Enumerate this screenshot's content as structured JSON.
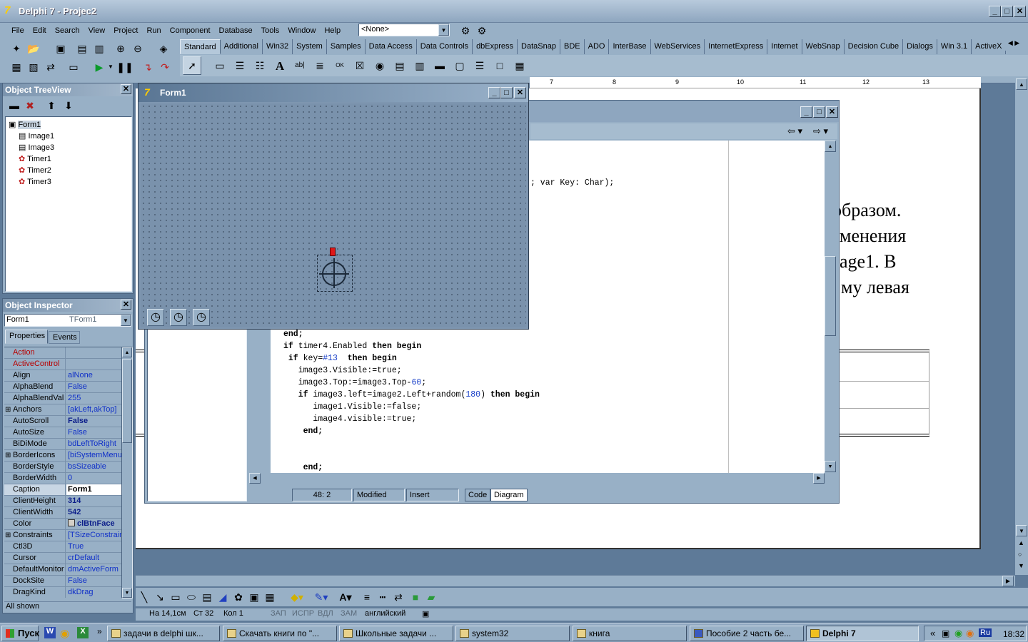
{
  "window": {
    "title": "Delphi 7 - Projec2"
  },
  "menu": [
    "File",
    "Edit",
    "Search",
    "View",
    "Project",
    "Run",
    "Component",
    "Database",
    "Tools",
    "Window",
    "Help"
  ],
  "toolbar": {
    "desktop_combo": "<None>"
  },
  "palette_tabs": [
    "Standard",
    "Additional",
    "Win32",
    "System",
    "Samples",
    "Data Access",
    "Data Controls",
    "dbExpress",
    "DataSnap",
    "BDE",
    "ADO",
    "InterBase",
    "WebServices",
    "InternetExpress",
    "Internet",
    "WebSnap",
    "Decision Cube",
    "Dialogs",
    "Win 3.1",
    "ActiveX"
  ],
  "ruler_numbers": [
    "7",
    "8",
    "9",
    "10",
    "11",
    "12",
    "13"
  ],
  "tree_view": {
    "title": "Object TreeView",
    "items": [
      "Form1",
      "Image1",
      "Image3",
      "Timer1",
      "Timer2",
      "Timer3"
    ]
  },
  "inspector": {
    "title": "Object Inspector",
    "object_name": "Form1",
    "object_type": "TForm1",
    "tabs": [
      "Properties",
      "Events"
    ],
    "status": "All shown",
    "props": [
      {
        "name": "Action",
        "value": "",
        "red": true
      },
      {
        "name": "ActiveControl",
        "value": "",
        "red": true
      },
      {
        "name": "Align",
        "value": "alNone"
      },
      {
        "name": "AlphaBlend",
        "value": "False"
      },
      {
        "name": "AlphaBlendVal",
        "value": "255"
      },
      {
        "name": "Anchors",
        "value": "[akLeft,akTop]",
        "plus": true
      },
      {
        "name": "AutoScroll",
        "value": "False",
        "bold": true
      },
      {
        "name": "AutoSize",
        "value": "False"
      },
      {
        "name": "BiDiMode",
        "value": "bdLeftToRight"
      },
      {
        "name": "BorderIcons",
        "value": "[biSystemMenu,",
        "plus": true
      },
      {
        "name": "BorderStyle",
        "value": "bsSizeable"
      },
      {
        "name": "BorderWidth",
        "value": "0"
      },
      {
        "name": "Caption",
        "value": "Form1",
        "selected": true
      },
      {
        "name": "ClientHeight",
        "value": "314",
        "bold": true
      },
      {
        "name": "ClientWidth",
        "value": "542",
        "bold": true
      },
      {
        "name": "Color",
        "value": "clBtnFace",
        "bold": true,
        "swatch": true
      },
      {
        "name": "Constraints",
        "value": "[TSizeConstrain",
        "plus": true
      },
      {
        "name": "Ctl3D",
        "value": "True"
      },
      {
        "name": "Cursor",
        "value": "crDefault"
      },
      {
        "name": "DefaultMonitor",
        "value": "dmActiveForm"
      },
      {
        "name": "DockSite",
        "value": "False"
      },
      {
        "name": "DragKind",
        "value": "dkDrag"
      }
    ]
  },
  "form": {
    "title": "Form1"
  },
  "editor": {
    "header_fragment": "; var Key: Char);",
    "lines": [
      [
        {
          "t": " end;",
          "c": "kw"
        }
      ],
      [
        {
          "t": "end;",
          "c": "kw"
        }
      ],
      [
        {
          "t": "if ",
          "c": "kw"
        },
        {
          "t": "timer4.Enabled "
        },
        {
          "t": "then begin",
          "c": "kw"
        }
      ],
      [
        {
          "t": " if ",
          "c": "kw"
        },
        {
          "t": "key="
        },
        {
          "t": "#13",
          "c": "num"
        },
        {
          "t": "  "
        },
        {
          "t": "then begin",
          "c": "kw"
        }
      ],
      [
        {
          "t": "   image3.Visible:=true;"
        }
      ],
      [
        {
          "t": "   image3.Top:=image3.Top-"
        },
        {
          "t": "60",
          "c": "num"
        },
        {
          "t": ";"
        }
      ],
      [
        {
          "t": "   if ",
          "c": "kw"
        },
        {
          "t": "image3.left=image2.Left+random("
        },
        {
          "t": "180",
          "c": "num"
        },
        {
          "t": ") "
        },
        {
          "t": "then begin",
          "c": "kw"
        }
      ],
      [
        {
          "t": "      image1.Visible:=false;"
        }
      ],
      [
        {
          "t": "      image4.visible:=true;"
        }
      ],
      [
        {
          "t": "    end;",
          "c": "kw"
        }
      ],
      [
        {
          "t": ""
        }
      ],
      [
        {
          "t": ""
        }
      ],
      [
        {
          "t": "    end;",
          "c": "kw"
        }
      ]
    ],
    "status": {
      "position": "48:  2",
      "modified": "Modified",
      "insert": "Insert"
    },
    "tabs": [
      "Code",
      "Diagram"
    ]
  },
  "document": {
    "lines": [
      "образом.",
      "менения",
      "age1.  В",
      "му левая"
    ]
  },
  "word_status": {
    "at": "На 14,1см",
    "line": "Ст 32",
    "col": "Кол 1",
    "flags": [
      "ЗАП",
      "ИСПР",
      "ВДЛ",
      "ЗАМ"
    ],
    "lang": "английский"
  },
  "taskbar": {
    "start": "Пуск",
    "tasks": [
      "задачи в delphi шк...",
      "Скачать книги по \"...",
      "Школьные задачи ...",
      "system32",
      "книга",
      "Пособие 2 часть бе...",
      "Delphi 7"
    ],
    "tray": {
      "lang": "Ru",
      "time": "18:32"
    }
  }
}
